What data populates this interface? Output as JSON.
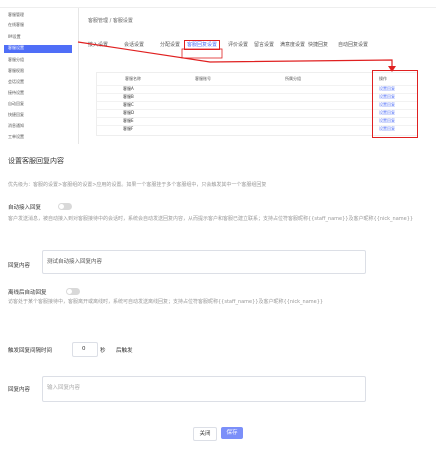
{
  "shot": {
    "sidebar": {
      "items": [
        {
          "label": "客服管理",
          "active": false
        },
        {
          "label": "在线客服",
          "active": false
        },
        {
          "label": "IM设置",
          "active": false
        },
        {
          "label": "客服设置",
          "active": true
        },
        {
          "label": "客服分组",
          "active": false
        },
        {
          "label": "客服权限",
          "active": false
        },
        {
          "label": "会话设置",
          "active": false
        },
        {
          "label": "接待设置",
          "active": false
        },
        {
          "label": "自动回复",
          "active": false
        },
        {
          "label": "快捷回复",
          "active": false
        },
        {
          "label": "消息通知",
          "active": false
        },
        {
          "label": "工单设置",
          "active": false
        }
      ]
    },
    "breadcrumb": "客服管理 / 客服设置",
    "tabs": [
      {
        "label": "接入设置",
        "highlighted": false
      },
      {
        "label": "会话设置",
        "highlighted": false
      },
      {
        "label": "分配设置",
        "highlighted": false
      },
      {
        "label": "客服回复设置",
        "highlighted": true
      },
      {
        "label": "评价设置",
        "highlighted": false
      },
      {
        "label": "留言设置",
        "highlighted": false
      },
      {
        "label": "满意度设置",
        "highlighted": false
      },
      {
        "label": "快捷回复",
        "highlighted": false
      },
      {
        "label": "自动回复设置",
        "highlighted": false
      }
    ],
    "table": {
      "headers": [
        "客服名称",
        "客服账号",
        "所属分组",
        "操作"
      ],
      "rows": [
        {
          "name": "客服A",
          "link": "设置回复"
        },
        {
          "name": "客服B",
          "link": "设置回复"
        },
        {
          "name": "客服C",
          "link": "设置回复"
        },
        {
          "name": "客服D",
          "link": "设置回复"
        },
        {
          "name": "客服E",
          "link": "设置回复"
        },
        {
          "name": "客服F",
          "link": "设置回复"
        }
      ]
    }
  },
  "form": {
    "title": "设置客服回复内容",
    "priority_hint": "优先级为：客服的设置>客服组的设置>应用的设置。如果一个客服挂于多个客服组中，只会触发其中一个客服组回复",
    "auto_reply": {
      "label": "自动接入回复",
      "desc": "客户发送消息，被自动接入到对客服接待中的会话时，系统会自动发送回复内容，从而提示客户和客服已建立联系；支持占位符客服昵称{{staff_name}}及客户昵称{{nick_name}}",
      "content_label": "回复内容",
      "content_value": "测试自动接入回复内容"
    },
    "offline_reply": {
      "label": "离线后自动回复",
      "desc": "访客处于某个客服接待中，客服离开或离线时，系统可自动发送离线回复；支持占位符客服昵称{{staff_name}}及客户昵称{{nick_name}}"
    },
    "trigger": {
      "label": "触发回复间隔时间",
      "value": "0",
      "unit": "秒",
      "suffix": "后触发"
    },
    "reply_content": {
      "label": "回复内容",
      "placeholder": "输入回复内容"
    },
    "buttons": {
      "cancel": "关闭",
      "save": "保存"
    }
  },
  "colors": {
    "accent": "#4f6ef7",
    "highlight": "#e02020"
  }
}
